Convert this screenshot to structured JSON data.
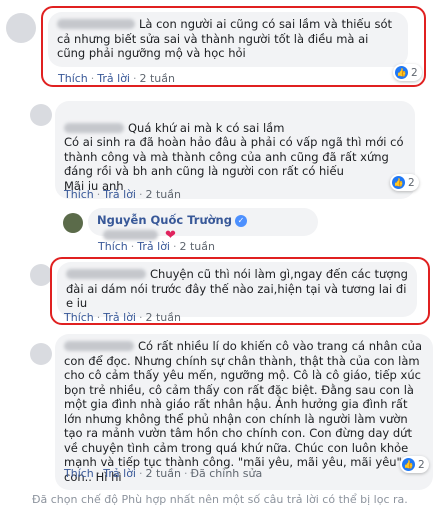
{
  "comments": [
    {
      "text": "Là con người ai cũng có sai lầm và thiếu sót cả nhưng biết sửa sai và thành người tốt là điều mà ai cũng phải ngưỡng mộ và học hỏi",
      "like": "Thích",
      "reply": "Trả lời",
      "time": "2 tuần",
      "reactions": "2"
    },
    {
      "text": "Quá khứ ai mà k có sai lầm\nCó ai sinh ra đã hoàn hảo đâu à phải có vấp ngã thì mới có thành công và mà thành công của anh cũng đã rất xứng đáng rồi và bh anh cũng là người con rất có hiếu\nMãi iu anh",
      "like": "Thích",
      "reply": "Trả lời",
      "time": "2 tuần",
      "reactions": "2"
    },
    {
      "author": "Nguyễn Quốc Trường",
      "like": "Thích",
      "reply": "Trả lời",
      "time": "2 tuần"
    },
    {
      "text": "Chuyện cũ thì nói làm gì,ngay đến các tượng đài ai dám nói trước đây thế nào zai,hiện tại và tương lai đi e iu",
      "like": "Thích",
      "reply": "Trả lời",
      "time": "2 tuần"
    },
    {
      "text": "Có rất nhiều lí do khiến cô vào trang cá nhân của con để đọc. Nhưng chính sự chân thành, thật thà của con làm cho cô cảm thấy yêu mến, ngưỡng mộ. Cô là cô giáo, tiếp xúc bọn trẻ nhiều, cô cảm thấy con rất đặc biệt. Đằng sau con là một gia đình nhà giáo rất nhân hậu. Ảnh hưởng gia đình rất lớn nhưng không thể phủ nhận con chính là người làm vườn tạo ra mảnh vườn tâm hồn cho chính con. Con đừng day dứt về chuyện tình cảm trong quá khứ nữa. Chúc con luôn khỏe mạnh và tiếp tục thành công. \"mãi yêu, mãi yêu, mãi yêu\" con.. Hì hì",
      "like": "Thích",
      "reply": "Trả lời",
      "time": "2 tuần",
      "edited": "Đã chỉnh sửa",
      "reactions": "2"
    }
  ],
  "notice": "Đã chọn chế độ Phù hợp nhất nên một số câu trả lời có thể bị lọc ra.",
  "colors": {
    "highlight": "#e02020",
    "link": "#385898",
    "bubble": "#f2f3f5"
  }
}
